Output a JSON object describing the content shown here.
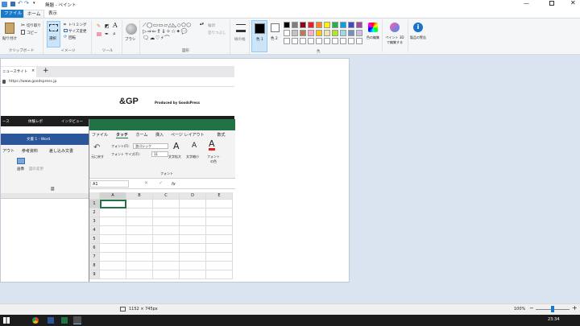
{
  "titlebar": {
    "title": "無題 - ペイント"
  },
  "tabs": {
    "file": "ファイル",
    "home": "ホーム",
    "view": "表示"
  },
  "ribbon": {
    "clipboard": {
      "paste": "貼り付け",
      "cut": "切り取り",
      "copy": "コピー",
      "label": "クリップボード"
    },
    "image": {
      "select": "選択",
      "crop": "トリミング",
      "resize": "サイズ変更",
      "rotate": "回転",
      "label": "イメージ"
    },
    "tools": {
      "text_icon": "A",
      "label": "ツール"
    },
    "brush": {
      "label": "ブラシ"
    },
    "shapes": {
      "outline": "輪郭",
      "fill": "塗りつぶし",
      "label": "図形"
    },
    "size": {
      "label": "線の幅"
    },
    "color1": {
      "label": "色 1"
    },
    "color2": {
      "label": "色 2"
    },
    "colors": {
      "label": "色",
      "edit": "色の編集",
      "paint3d": "ペイント 3D で編集する",
      "alert": "製品の警告"
    }
  },
  "palette": [
    "#000000",
    "#7f7f7f",
    "#880015",
    "#ed1c24",
    "#ff7f27",
    "#fff200",
    "#22b14c",
    "#00a2e8",
    "#3f48cc",
    "#a349a4",
    "#ffffff",
    "#c3c3c3",
    "#b97a57",
    "#ffaec9",
    "#ffc90e",
    "#efe4b0",
    "#b5e61d",
    "#99d9ea",
    "#7092be",
    "#c8bfe7"
  ],
  "canvas": {
    "browser": {
      "tab_title": "ニュースサイト",
      "url": "https://www.goodspress.jp",
      "logo": "&GP",
      "logo_sub": "Produced by GoodsPress",
      "nav": [
        "ース",
        "体験レポ",
        "インタビュー"
      ]
    },
    "word": {
      "title": "文書 1 - Word",
      "tabs": [
        "アウト",
        "参考資料",
        "差し込み文書"
      ],
      "items": [
        "画像",
        "図の変更"
      ],
      "g_label": "図"
    },
    "excel": {
      "tabs": [
        "ファイル",
        "タッチ",
        "ホーム",
        "挿入",
        "ページ レイアウト",
        "数式"
      ],
      "undo": "元に戻す",
      "font_label": "フォント(F):",
      "font_value": "游ゴシック",
      "size_label": "フォント サイズ(F):",
      "size_value": "11",
      "grow": "文字拡大",
      "shrink": "文字縮小",
      "fcolor": "フォントの色",
      "group": "フォント",
      "cellref": "A1",
      "fx": "fx",
      "cols": [
        "A",
        "B",
        "C",
        "D",
        "E"
      ],
      "rows": [
        "1",
        "2",
        "3",
        "4",
        "5",
        "6",
        "7",
        "8",
        "9"
      ]
    }
  },
  "status": {
    "size": "1152 × 745px",
    "zoom": "100%"
  },
  "taskbar": {
    "time": "23:34"
  }
}
